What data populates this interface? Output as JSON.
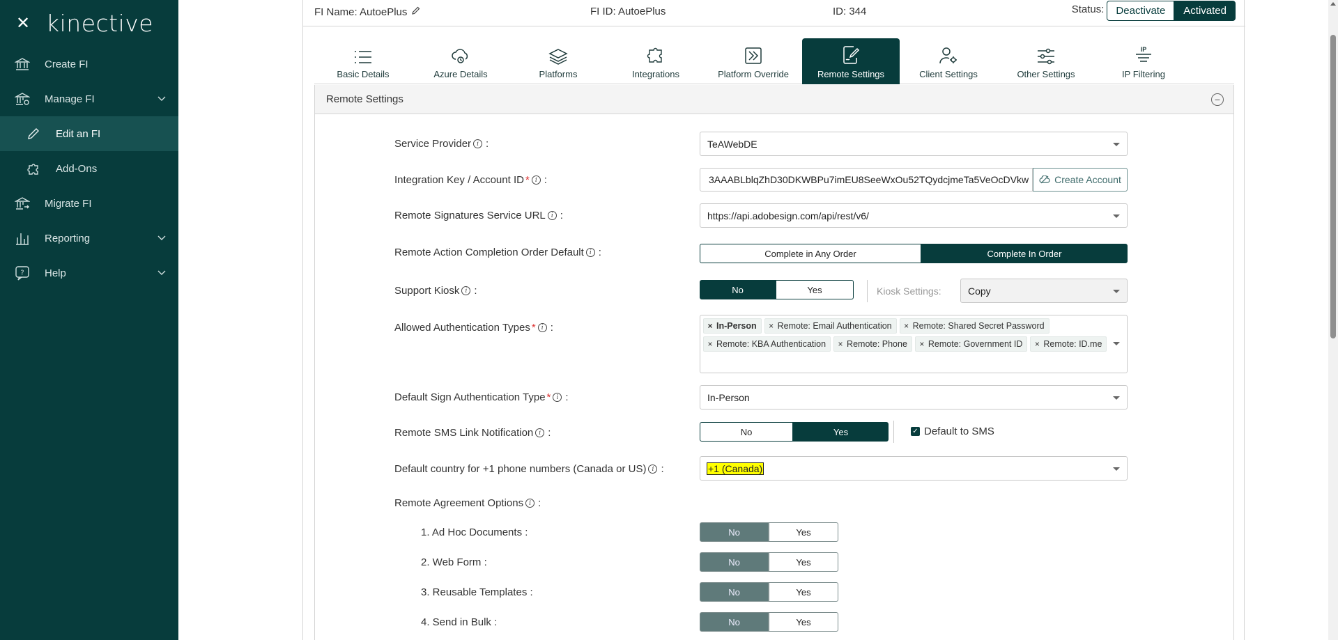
{
  "sidebar": {
    "close": "✕",
    "logo": "kinective",
    "items": [
      {
        "label": "Create FI"
      },
      {
        "label": "Manage FI"
      },
      {
        "label": "Edit an FI"
      },
      {
        "label": "Add-Ons"
      },
      {
        "label": "Migrate FI"
      },
      {
        "label": "Reporting"
      },
      {
        "label": "Help"
      }
    ]
  },
  "topbar": {
    "fi_name": "FI Name: AutoePlus",
    "fi_id": "FI ID: AutoePlus",
    "id": "ID: 344",
    "status_label": "Status:",
    "deactivate": "Deactivate",
    "activated": "Activated"
  },
  "tabs": [
    {
      "label": "Basic Details"
    },
    {
      "label": "Azure Details"
    },
    {
      "label": "Platforms"
    },
    {
      "label": "Integrations"
    },
    {
      "label": "Platform Override"
    },
    {
      "label": "Remote Settings"
    },
    {
      "label": "Client Settings"
    },
    {
      "label": "Other Settings"
    },
    {
      "label": "IP Filtering"
    }
  ],
  "card": {
    "title": "Remote Settings",
    "collapse": "−"
  },
  "form": {
    "service_provider": {
      "label": "Service Provider",
      "value": "TeAWebDE"
    },
    "integration_key": {
      "label": "Integration Key / Account ID",
      "value": "3AAABLblqZhD30DKWBPu7imEU8SeeWxOu52TQydcjmeTa5VeOcDVkw",
      "button": "Create Account"
    },
    "signatures_url": {
      "label": "Remote Signatures Service URL",
      "value": "https://api.adobesign.com/api/rest/v6/"
    },
    "completion_order": {
      "label": "Remote Action Completion Order Default",
      "opt1": "Complete in Any Order",
      "opt2": "Complete In Order"
    },
    "support_kiosk": {
      "label": "Support Kiosk",
      "no": "No",
      "yes": "Yes",
      "kiosk_settings_label": "Kiosk Settings:",
      "kiosk_settings_value": "Copy"
    },
    "auth_types": {
      "label": "Allowed Authentication Types",
      "tags": [
        "In-Person",
        "Remote: Email Authentication",
        "Remote: Shared Secret Password",
        "Remote: KBA Authentication",
        "Remote: Phone",
        "Remote: Government ID",
        "Remote: ID.me"
      ]
    },
    "default_sign_auth": {
      "label": "Default Sign Authentication Type",
      "value": "In-Person"
    },
    "sms_link": {
      "label": "Remote SMS Link Notification",
      "no": "No",
      "yes": "Yes",
      "default_sms": "Default to SMS"
    },
    "default_country": {
      "label": "Default country for +1 phone numbers (Canada or US)",
      "value": "+1 (Canada)"
    },
    "agreement_options": {
      "label": "Remote Agreement Options",
      "items": [
        {
          "label": "1. Ad Hoc Documents :",
          "no": "No",
          "yes": "Yes"
        },
        {
          "label": "2. Web Form :",
          "no": "No",
          "yes": "Yes"
        },
        {
          "label": "3. Reusable Templates :",
          "no": "No",
          "yes": "Yes"
        },
        {
          "label": "4. Send in Bulk :",
          "no": "No",
          "yes": "Yes"
        }
      ]
    }
  },
  "colors": {
    "sidebar_bg": "#073c3c",
    "accent": "#073c3c",
    "highlight": "#ffff00"
  }
}
